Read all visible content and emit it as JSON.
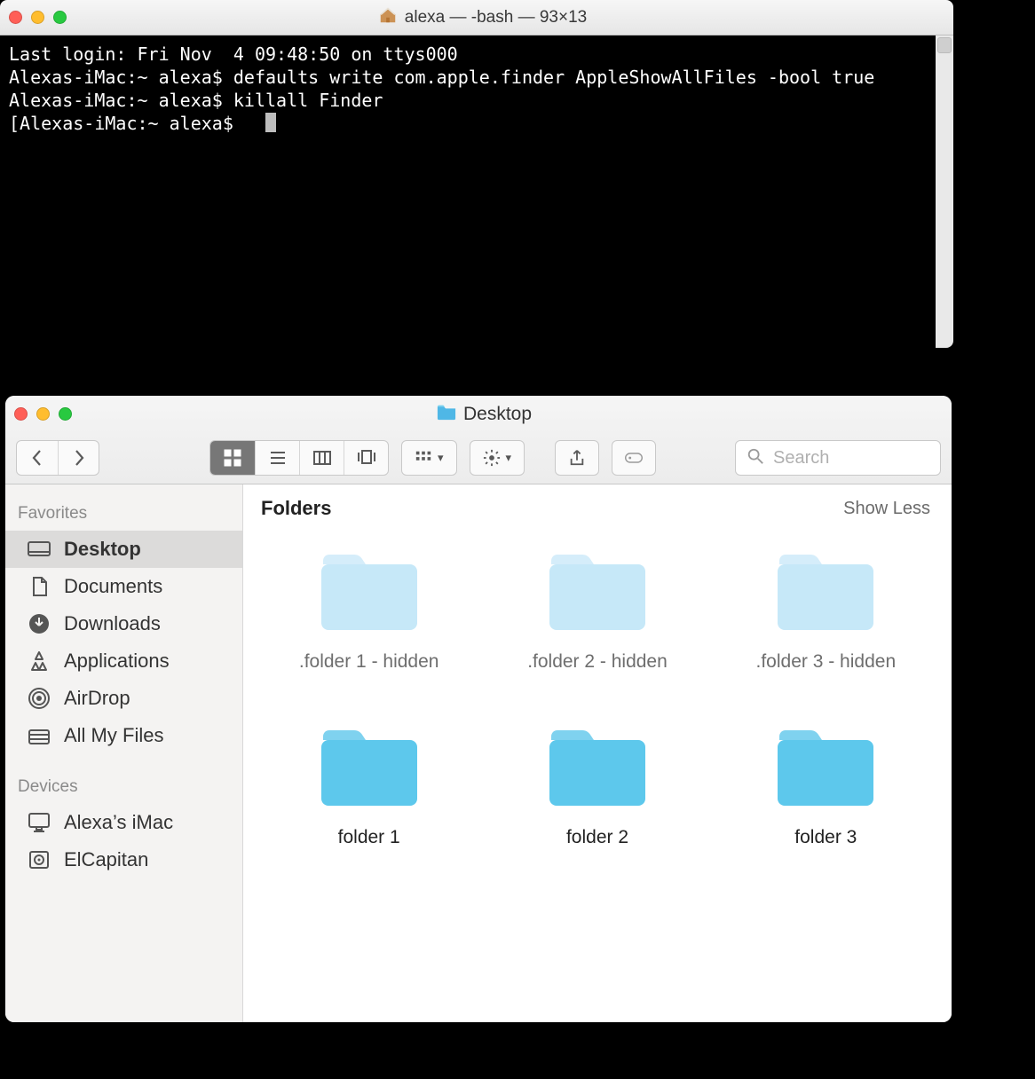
{
  "terminal": {
    "title": "alexa — -bash — 93×13",
    "lines": [
      "Last login: Fri Nov  4 09:48:50 on ttys000",
      "Alexas-iMac:~ alexa$ defaults write com.apple.finder AppleShowAllFiles -bool true",
      "Alexas-iMac:~ alexa$ killall Finder",
      "[Alexas-iMac:~ alexa$ "
    ]
  },
  "finder": {
    "title": "Desktop",
    "search_placeholder": "Search",
    "section_title": "Folders",
    "section_action": "Show Less",
    "sidebar": {
      "headings": {
        "favorites": "Favorites",
        "devices": "Devices"
      },
      "favorites": [
        {
          "icon": "desktop",
          "label": "Desktop",
          "active": true
        },
        {
          "icon": "documents",
          "label": "Documents"
        },
        {
          "icon": "downloads",
          "label": "Downloads"
        },
        {
          "icon": "applications",
          "label": "Applications"
        },
        {
          "icon": "airdrop",
          "label": "AirDrop"
        },
        {
          "icon": "allmyfiles",
          "label": "All My Files"
        }
      ],
      "devices": [
        {
          "icon": "imac",
          "label": "Alexa’s iMac"
        },
        {
          "icon": "disk",
          "label": "ElCapitan"
        }
      ]
    },
    "folders": [
      {
        "name": ".folder 1 - hidden",
        "hidden": true
      },
      {
        "name": ".folder 2 - hidden",
        "hidden": true
      },
      {
        "name": ".folder 3 - hidden",
        "hidden": true
      },
      {
        "name": "folder 1",
        "hidden": false
      },
      {
        "name": "folder 2",
        "hidden": false
      },
      {
        "name": "folder 3",
        "hidden": false
      }
    ]
  }
}
